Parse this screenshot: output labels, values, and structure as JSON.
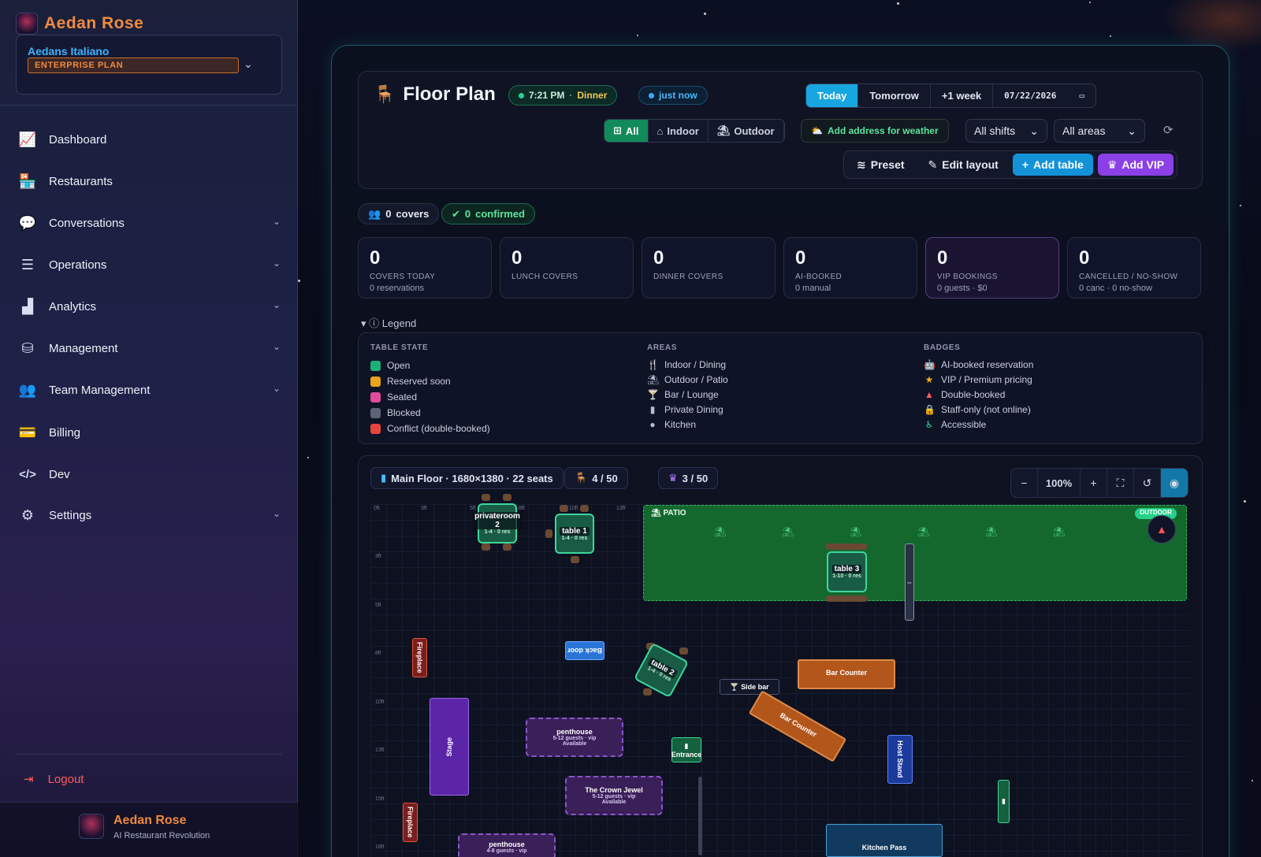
{
  "sidebar": {
    "brand": "Aedan Rose",
    "org_name": "Aedans Italiano",
    "plan": "ENTERPRISE PLAN",
    "items": [
      {
        "label": "Dashboard",
        "icon": "chart-line-icon",
        "glyph": "⟋"
      },
      {
        "label": "Restaurants",
        "icon": "store-icon",
        "glyph": "▤"
      },
      {
        "label": "Conversations",
        "icon": "chat-bubbles-icon",
        "glyph": "💬"
      },
      {
        "label": "Operations",
        "icon": "checklist-icon",
        "glyph": "☰"
      },
      {
        "label": "Analytics",
        "icon": "bar-chart-icon",
        "glyph": "▟"
      },
      {
        "label": "Management",
        "icon": "database-icon",
        "glyph": "⛁"
      },
      {
        "label": "Team Management",
        "icon": "users-icon",
        "glyph": "👥"
      },
      {
        "label": "Billing",
        "icon": "credit-card-icon",
        "glyph": "▭"
      },
      {
        "label": "Dev",
        "icon": "code-icon",
        "glyph": "</>"
      },
      {
        "label": "Settings",
        "icon": "gear-icon",
        "glyph": "⚙"
      }
    ],
    "logout": "Logout",
    "footer_name": "Aedan Rose",
    "footer_sub": "AI Restaurant Revolution"
  },
  "header": {
    "title": "Floor Plan",
    "time": "7:21 PM",
    "sep": "·",
    "shift": "Dinner",
    "updated": "just now",
    "days": [
      "Today",
      "Tomorrow",
      "+1 week"
    ],
    "date": "07/22/2026",
    "filters": [
      "All",
      "Indoor",
      "Outdoor"
    ],
    "weather": "Add address for weather",
    "shifts_select": "All shifts",
    "areas_select": "All areas",
    "actions": {
      "preset": "Preset",
      "edit": "Edit layout",
      "add_table": "Add table",
      "add_vip": "Add VIP"
    }
  },
  "chips": {
    "covers": "0",
    "covers_label": "covers",
    "confirmed": "0",
    "confirmed_label": "confirmed"
  },
  "stats": [
    {
      "n": "0",
      "l": "COVERS TODAY",
      "s": "0 reservations"
    },
    {
      "n": "0",
      "l": "LUNCH COVERS",
      "s": ""
    },
    {
      "n": "0",
      "l": "DINNER COVERS",
      "s": ""
    },
    {
      "n": "0",
      "l": "AI-BOOKED",
      "s": "0 manual"
    },
    {
      "n": "0",
      "l": "VIP BOOKINGS",
      "s": "0 guests · $0"
    },
    {
      "n": "0",
      "l": "CANCELLED / NO-SHOW",
      "s": "0 canc · 0 no-show"
    }
  ],
  "legend": {
    "title": "Legend",
    "table_state_h": "TABLE STATE",
    "areas_h": "AREAS",
    "badges_h": "BADGES",
    "states": [
      {
        "label": "Open",
        "color": "#1fb07a"
      },
      {
        "label": "Reserved soon",
        "color": "#e9a21c"
      },
      {
        "label": "Seated",
        "color": "#e04c9a"
      },
      {
        "label": "Blocked",
        "color": "#5d6478"
      },
      {
        "label": "Conflict (double-booked)",
        "color": "#e8443e"
      }
    ],
    "areas": [
      {
        "label": "Indoor / Dining",
        "glyph": "🍴"
      },
      {
        "label": "Outdoor / Patio",
        "glyph": "⛱"
      },
      {
        "label": "Bar / Lounge",
        "glyph": "🍸"
      },
      {
        "label": "Private Dining",
        "glyph": "▮"
      },
      {
        "label": "Kitchen",
        "glyph": "●"
      }
    ],
    "badges": [
      {
        "label": "AI-booked reservation",
        "glyph": "🤖",
        "color": "#4ab8ff"
      },
      {
        "label": "VIP / Premium pricing",
        "glyph": "★",
        "color": "#f2b01e"
      },
      {
        "label": "Double-booked",
        "glyph": "▲",
        "color": "#ff5a5a"
      },
      {
        "label": "Staff-only (not online)",
        "glyph": "🔒",
        "color": "#b8bfd3"
      },
      {
        "label": "Accessible",
        "glyph": "♿",
        "color": "#3fd59b"
      }
    ]
  },
  "floor": {
    "info": "Main Floor · 1680×1380 · 22 seats",
    "tables_count": "4 / 50",
    "vip_count": "3 / 50",
    "zoom": "100%",
    "patio": "PATIO",
    "outdoor_badge": "OUTDOOR",
    "tables": {
      "privateroom2": {
        "name": "privateroom 2",
        "sub": "1-4 · 0 res"
      },
      "table1": {
        "name": "table 1",
        "sub": "1-4 · 0 res"
      },
      "table3": {
        "name": "table 3",
        "sub": "1-10 · 0 res"
      },
      "table2": {
        "name": "table 2",
        "sub": "1-4 · 0 res"
      }
    },
    "objects": {
      "back_door": "Back door",
      "side_bar": "Side bar",
      "bar_counter": "Bar Counter",
      "bar_counter2": "Bar Counter",
      "stage": "Stage",
      "entrance": "Entrance",
      "host_stand": "Host Stand",
      "kitchen_pass": "Kitchen Pass",
      "fireplace1": "Fireplace",
      "fireplace2": "Fireplace"
    },
    "vip": [
      {
        "name": "penthouse",
        "guests": "5-12 guests · vip",
        "status": "Available"
      },
      {
        "name": "The Crown Jewel",
        "guests": "5-12 guests · vip",
        "status": "Available"
      },
      {
        "name": "penthouse",
        "guests": "4-8 guests · vip",
        "status": ""
      }
    ],
    "rulers_top": [
      "0ft",
      "3ft",
      "5ft",
      "8ft",
      "10ft",
      "13ft"
    ],
    "rulers_left": [
      "3ft",
      "5ft",
      "8ft",
      "10ft",
      "13ft",
      "15ft",
      "18ft"
    ]
  }
}
